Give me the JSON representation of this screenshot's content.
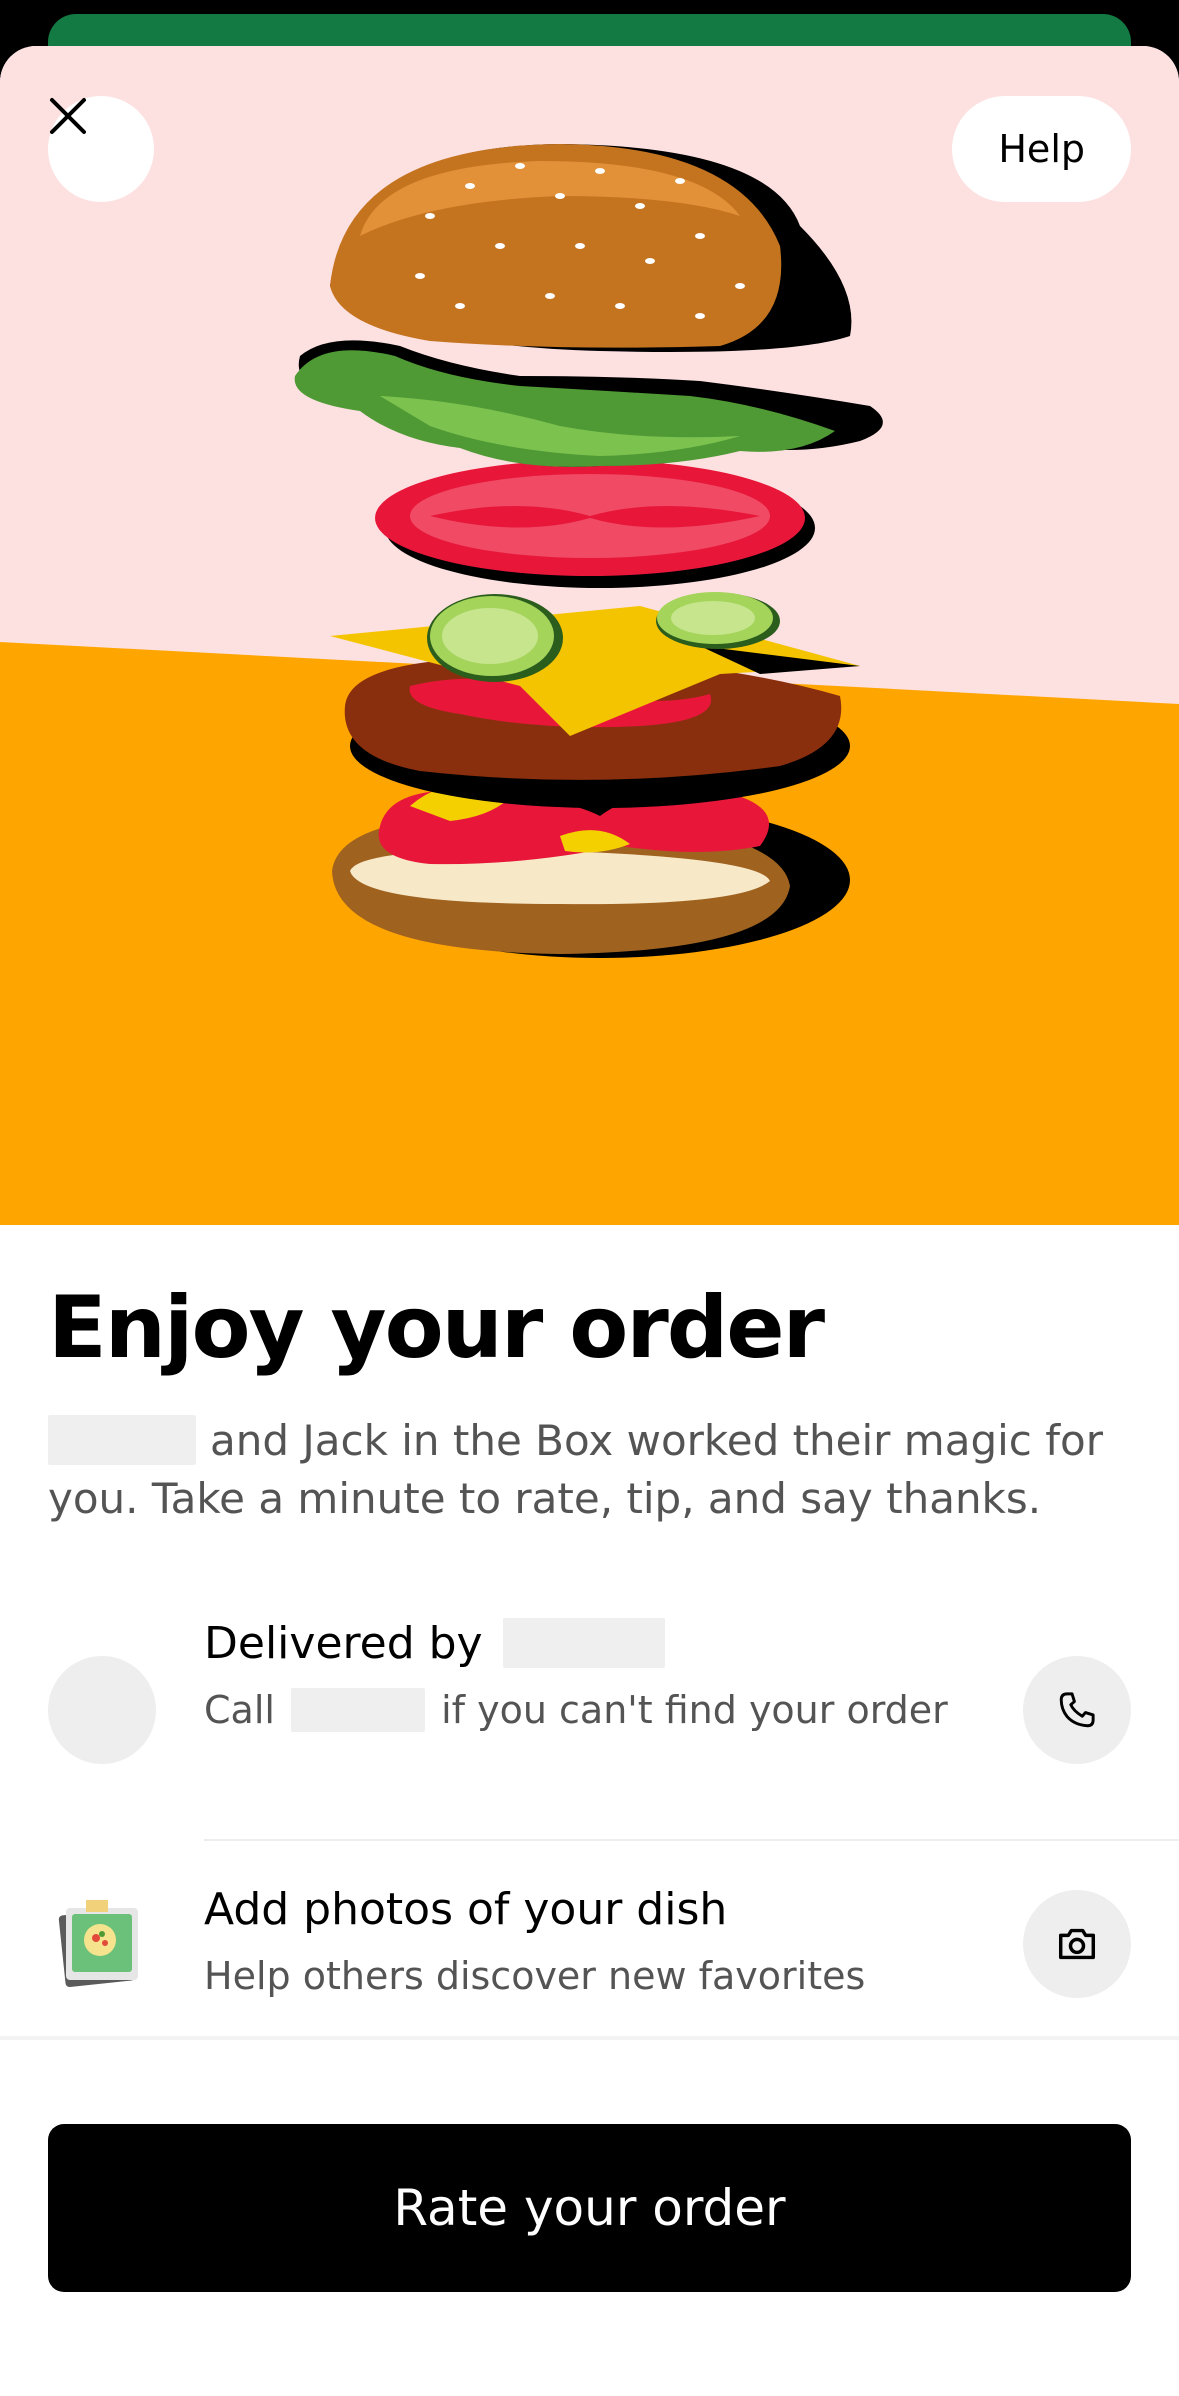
{
  "header": {
    "help_label": "Help"
  },
  "content": {
    "title": "Enjoy your order",
    "subtitle_line": "and Jack in the Box worked their magic for you. Take a minute to rate, tip, and say thanks."
  },
  "courier": {
    "title_prefix": "Delivered by",
    "call_prefix": "Call",
    "call_suffix": "if you can't find your order"
  },
  "photos": {
    "title": "Add photos of your dish",
    "subtitle": "Help others discover new favorites"
  },
  "footer": {
    "cta_label": "Rate your order"
  },
  "colors": {
    "hero_pink": "#fde0e0",
    "hero_orange": "#ffa500",
    "accent_green": "#127a42",
    "cta_background": "#000000"
  },
  "icons": {
    "close": "close-icon",
    "phone": "phone-icon",
    "camera": "camera-icon"
  }
}
